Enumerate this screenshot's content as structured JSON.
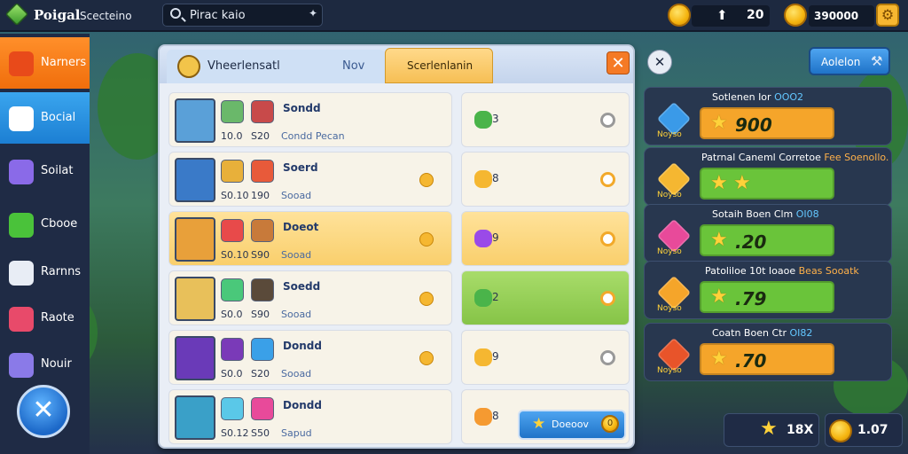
{
  "app": {
    "title": "Poigal",
    "subtitle": "Scecteino"
  },
  "search": {
    "text": "Pirac kaio"
  },
  "currency": {
    "energy": "20",
    "gold": "390000"
  },
  "sidebar": {
    "items": [
      {
        "label": "Narners",
        "icon": "sword-icon",
        "color": "#e84a1a"
      },
      {
        "label": "Bocial",
        "icon": "social-icon",
        "color": "#ffffff"
      },
      {
        "label": "Soilat",
        "icon": "crystal-icon",
        "color": "#8a6ae8"
      },
      {
        "label": "Cbooe",
        "icon": "leaf-icon",
        "color": "#4ac23a"
      },
      {
        "label": "Rarnns",
        "icon": "cube-icon",
        "color": "#e8edf5"
      },
      {
        "label": "Raote",
        "icon": "chart-icon",
        "color": "#e84a6a"
      },
      {
        "label": "Nouir",
        "icon": "gem-icon",
        "color": "#8a7ae8"
      }
    ]
  },
  "panel": {
    "tab_main": "Vheerlensatl",
    "tab_nov": "Nov",
    "tab_second": "Scerlenlanin",
    "rows": [
      {
        "name": "Sondd",
        "v1": "10.0",
        "v2": "S20",
        "sub": "Condd  Pecan",
        "res": "3",
        "res_color": "#4ab44a",
        "radio": "off",
        "hl": false,
        "green": false,
        "dot": false
      },
      {
        "name": "Soerd",
        "v1": "S0.10",
        "v2": "190",
        "sub": "Sooad",
        "res": "8",
        "res_color": "#f5b731",
        "radio": "on",
        "hl": false,
        "green": false,
        "dot": true
      },
      {
        "name": "Doeot",
        "v1": "S0.10",
        "v2": "S90",
        "sub": "Sooad",
        "res": "9",
        "res_color": "#9a4ae8",
        "radio": "on",
        "hl": true,
        "green": false,
        "dot": true
      },
      {
        "name": "Soedd",
        "v1": "S0.0",
        "v2": "S90",
        "sub": "Sooad",
        "res": "2",
        "res_color": "#4ab44a",
        "radio": "on",
        "hl": false,
        "green": true,
        "dot": true
      },
      {
        "name": "Dondd",
        "v1": "S0.0",
        "v2": "S20",
        "sub": "Sooad",
        "res": "9",
        "res_color": "#f5b731",
        "radio": "off",
        "hl": false,
        "green": false,
        "dot": true
      },
      {
        "name": "Dondd",
        "v1": "S0.12",
        "v2": "S50",
        "sub": "Sapud",
        "res": "8",
        "res_color": "#f59a31",
        "radio": "off",
        "hl": false,
        "green": false,
        "dot": false
      }
    ],
    "claim_label": "Doeoov",
    "claim_coin": "0"
  },
  "right": {
    "button_label": "Aolelon",
    "cards": [
      {
        "title": "Sotlenen",
        "title2": "Ior",
        "title3": "OOO2",
        "value": "900",
        "bar_color": "#f5a52a",
        "gem_color": "#3a9ae8"
      },
      {
        "title": "Patrnal Caneml",
        "title2": "Corretoe",
        "title3": "Fee Soenollo.",
        "value": "",
        "bar_color": "#6ac43a",
        "gem_color": "#f5b731"
      },
      {
        "title": "Sotaih Boen",
        "title2": "Clm",
        "title3": "OI08",
        "value": ".20",
        "bar_color": "#6ac43a",
        "gem_color": "#e84a9a"
      },
      {
        "title": "Patoliloe 10t",
        "title2": "Ioaoe",
        "title3": "Beas Sooatk",
        "value": ".79",
        "bar_color": "#6ac43a",
        "gem_color": "#f5a52a"
      },
      {
        "title": "Coatn Boen",
        "title2": "Ctr",
        "title3": "OI82",
        "value": ".70",
        "bar_color": "#f5a52a",
        "gem_color": "#e8542a"
      }
    ],
    "gem_tag": "Noyso",
    "bottom_stars": "18X",
    "bottom_coins": "1.07"
  },
  "colors": {
    "accent_orange": "#f06e0c",
    "accent_blue": "#1c7fd3",
    "panel_bg": "#e9eef6"
  }
}
